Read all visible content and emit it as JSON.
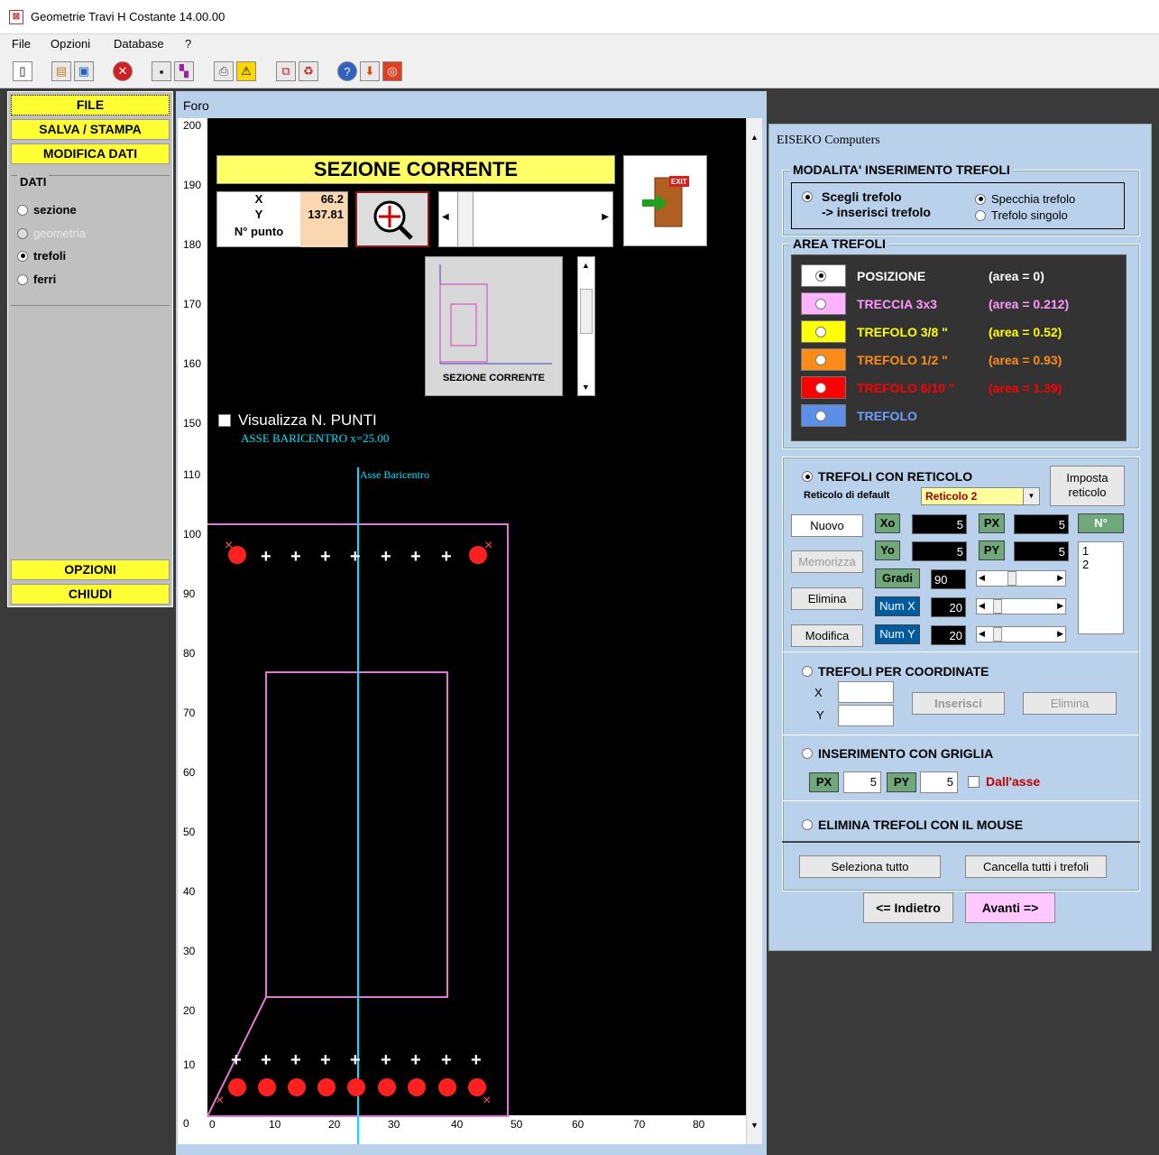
{
  "window": {
    "title": "Geometrie Travi H Costante  14.00.00"
  },
  "menu": {
    "file": "File",
    "opzioni": "Opzioni",
    "database": "Database",
    "help": "?"
  },
  "left_panel": {
    "file": "FILE",
    "salva": "SALVA / STAMPA",
    "modifica": "MODIFICA DATI",
    "dati_title": "DATI",
    "items": [
      {
        "label": "sezione",
        "selected": false,
        "enabled": true
      },
      {
        "label": "geometria",
        "selected": false,
        "enabled": false
      },
      {
        "label": "trefoli",
        "selected": true,
        "enabled": true
      },
      {
        "label": "ferri",
        "selected": false,
        "enabled": true
      }
    ],
    "opzioni": "OPZIONI",
    "chiudi": "CHIUDI"
  },
  "foro": {
    "title": "Foro",
    "banner": "SEZIONE CORRENTE",
    "x_label": "X",
    "y_label": "Y",
    "n_label": "N° punto",
    "x_value": "66.2",
    "y_value": "137.81",
    "thumb_caption": "SEZIONE CORRENTE",
    "visualizza": "Visualizza N. PUNTI",
    "asse_text": "ASSE BARICENTRO  x=25.00",
    "asse_label": "Asse Baricentro",
    "y_ticks": [
      "200",
      "190",
      "180",
      "170",
      "160",
      "150",
      "110",
      "100",
      "90",
      "80",
      "70",
      "60",
      "50",
      "40",
      "30",
      "20",
      "10",
      "0"
    ],
    "x_ticks": [
      "0",
      "10",
      "20",
      "30",
      "40",
      "50",
      "60",
      "70",
      "80"
    ]
  },
  "right_panel": {
    "header": "EISEKO Computers",
    "modalita_title": "MODALITA' INSERIMENTO TREFOLI",
    "scegli_1": "Scegli trefolo",
    "scegli_2": "-> inserisci trefolo",
    "specchia": "Specchia trefolo",
    "singolo": "Trefolo singolo",
    "area_title": "AREA TREFOLI",
    "area_items": [
      {
        "name": "POSIZIONE",
        "area": "(area = 0)",
        "swatch": "#ffffff",
        "color": "#ffffff"
      },
      {
        "name": "TRECCIA  3x3",
        "area": "(area = 0.212)",
        "swatch": "#ffb3ff",
        "color": "#ff99ff"
      },
      {
        "name": "TREFOLO 3/8 \"",
        "area": "(area = 0.52)",
        "swatch": "#ffff00",
        "color": "#ffff00"
      },
      {
        "name": "TREFOLO 1/2 \"",
        "area": "(area = 0.93)",
        "swatch": "#ff8c1a",
        "color": "#ff8c1a"
      },
      {
        "name": "TREFOLO 6/10 \"",
        "area": "(area = 1.39)",
        "swatch": "#ff0000",
        "color": "#ff0000"
      },
      {
        "name": "TREFOLO",
        "area": "",
        "swatch": "#5b8fe8",
        "color": "#6fa0ff"
      }
    ],
    "reticolo_title": "TREFOLI CON RETICOLO",
    "reticolo_default": "Reticolo di default",
    "reticolo_value": "Reticolo 2",
    "imposta_1": "Imposta",
    "imposta_2": "reticolo",
    "nuovo": "Nuovo",
    "memorizza": "Memorizza",
    "elimina": "Elimina",
    "modifica": "Modifica",
    "xo": "Xo",
    "yo": "Yo",
    "px": "PX",
    "py": "PY",
    "n": "N°",
    "gradi": "Gradi",
    "numx": "Num X",
    "numy": "Num Y",
    "xo_val": "5",
    "yo_val": "5",
    "px_val": "5",
    "py_val": "5",
    "gradi_val": "90",
    "numx_val": "20",
    "numy_val": "20",
    "list": [
      "1",
      "2"
    ],
    "coord_title": "TREFOLI PER COORDINATE",
    "coord_x": "X",
    "coord_y": "Y",
    "inserisci": "Inserisci",
    "elimina2": "Elimina",
    "griglia_title": "INSERIMENTO CON GRIGLIA",
    "g_px": "PX",
    "g_py": "PY",
    "g_px_val": "5",
    "g_py_val": "5",
    "dallasse": "Dall'asse",
    "mouse_title": "ELIMINA TREFOLI CON IL MOUSE",
    "seleziona": "Seleziona tutto",
    "cancella": "Cancella tutti i trefoli",
    "indietro": "<= Indietro",
    "avanti": "Avanti =>"
  }
}
